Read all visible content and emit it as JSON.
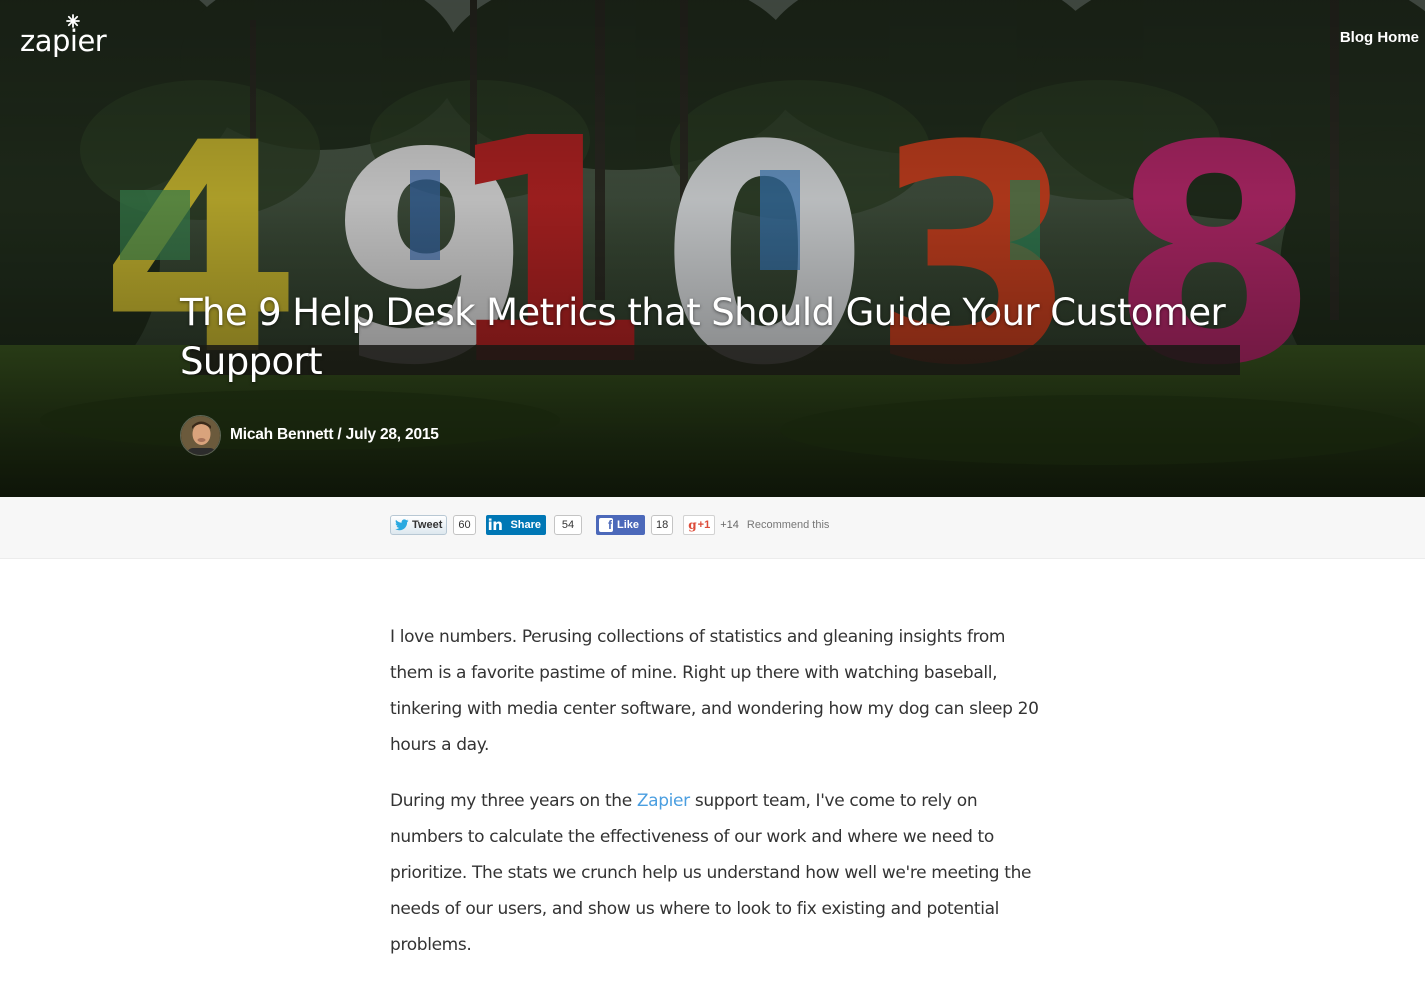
{
  "header": {
    "logo_text": "zapier",
    "nav_link": "Blog Home"
  },
  "post": {
    "title": "The 9 Help Desk Metrics that Should Guide Your Customer Support",
    "byline": "Micah Bennett / July 28, 2015",
    "hero_numbers": [
      "4",
      "9",
      "1",
      "0",
      "3",
      "8"
    ]
  },
  "share": {
    "tweet_label": "Tweet",
    "tweet_count": "60",
    "linkedin_logo": "in",
    "linkedin_label": "Share",
    "linkedin_count": "54",
    "facebook_logo": "f",
    "facebook_label": "Like",
    "facebook_count": "18",
    "gplus_label": "+1",
    "gplus_g": "g",
    "gplus_count": "+14",
    "recommend_text": "Recommend this"
  },
  "article": {
    "p1": "I love numbers. Perusing collections of statistics and gleaning insights from them is a favorite pastime of mine. Right up there with watching baseball, tinkering with media center software, and wondering how my dog can sleep 20 hours a day.",
    "p2_before": "During my three years on the ",
    "p2_link": "Zapier",
    "p2_after": " support team, I've come to rely on numbers to calculate the effectiveness of our work and where we need to prioritize. The stats we crunch help us understand how well we're meeting the needs of our users, and show us where to look to fix existing and potential problems."
  },
  "colors": {
    "link": "#4a9ee0",
    "body_text": "#333333",
    "share_bar_bg": "#f7f7f7",
    "linkedin": "#0077b5",
    "facebook": "#4c69ba",
    "gplus": "#dd4b39",
    "hero_numbers": [
      "#c9b830",
      "#e6e6e6",
      "#b52323",
      "#dcdcdc",
      "#c8401f",
      "#b5286a"
    ]
  },
  "icons": {
    "logo_mark": "asterisk-icon",
    "twitter": "twitter-bird-icon",
    "linkedin": "linkedin-icon",
    "facebook": "facebook-icon",
    "gplus": "google-plus-icon"
  }
}
